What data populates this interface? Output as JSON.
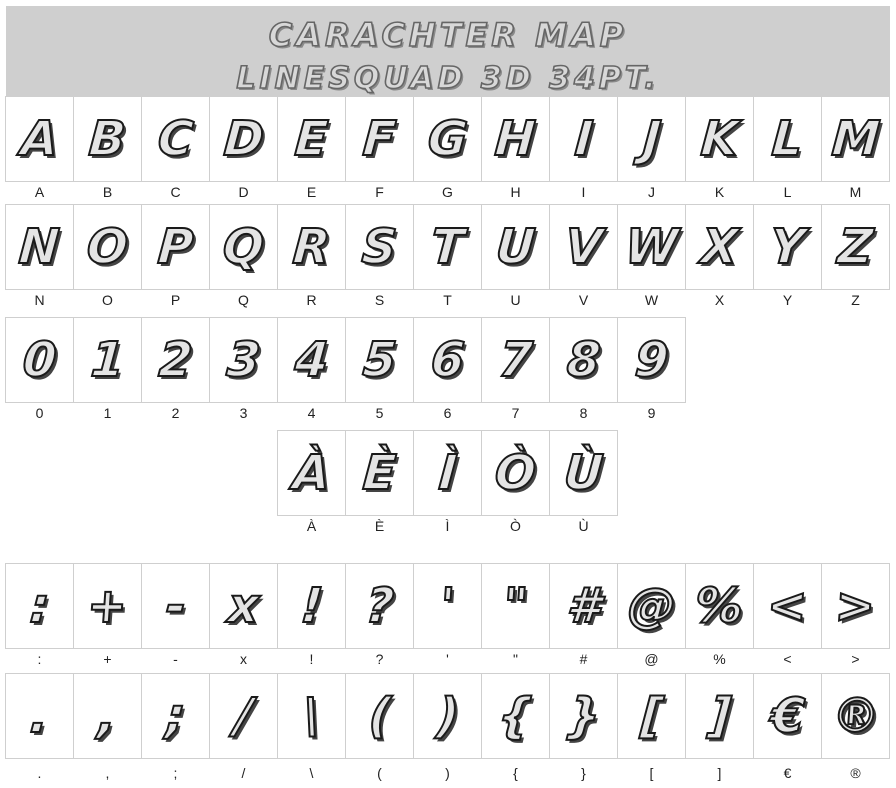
{
  "header": {
    "title_line1": "CARACHTER MAP",
    "title_line2": "LINESQUAD 3D 34PT."
  },
  "rows": [
    {
      "id": "uppercase-1",
      "start": 0,
      "glyphs": [
        {
          "char": "A",
          "label": "A"
        },
        {
          "char": "B",
          "label": "B"
        },
        {
          "char": "C",
          "label": "C"
        },
        {
          "char": "D",
          "label": "D"
        },
        {
          "char": "E",
          "label": "E"
        },
        {
          "char": "F",
          "label": "F"
        },
        {
          "char": "G",
          "label": "G"
        },
        {
          "char": "H",
          "label": "H"
        },
        {
          "char": "I",
          "label": "I"
        },
        {
          "char": "J",
          "label": "J"
        },
        {
          "char": "K",
          "label": "K"
        },
        {
          "char": "L",
          "label": "L"
        },
        {
          "char": "M",
          "label": "M"
        }
      ]
    },
    {
      "id": "uppercase-2",
      "start": 0,
      "glyphs": [
        {
          "char": "N",
          "label": "N"
        },
        {
          "char": "O",
          "label": "O"
        },
        {
          "char": "P",
          "label": "P"
        },
        {
          "char": "Q",
          "label": "Q"
        },
        {
          "char": "R",
          "label": "R"
        },
        {
          "char": "S",
          "label": "S"
        },
        {
          "char": "T",
          "label": "T"
        },
        {
          "char": "U",
          "label": "U"
        },
        {
          "char": "V",
          "label": "V"
        },
        {
          "char": "W",
          "label": "W"
        },
        {
          "char": "X",
          "label": "X"
        },
        {
          "char": "Y",
          "label": "Y"
        },
        {
          "char": "Z",
          "label": "Z"
        }
      ]
    },
    {
      "id": "digits",
      "start": 0,
      "glyphs": [
        {
          "char": "0",
          "label": "0"
        },
        {
          "char": "1",
          "label": "1"
        },
        {
          "char": "2",
          "label": "2"
        },
        {
          "char": "3",
          "label": "3"
        },
        {
          "char": "4",
          "label": "4"
        },
        {
          "char": "5",
          "label": "5"
        },
        {
          "char": "6",
          "label": "6"
        },
        {
          "char": "7",
          "label": "7"
        },
        {
          "char": "8",
          "label": "8"
        },
        {
          "char": "9",
          "label": "9"
        }
      ]
    },
    {
      "id": "accented",
      "start": 4,
      "glyphs": [
        {
          "char": "À",
          "label": "À"
        },
        {
          "char": "È",
          "label": "È"
        },
        {
          "char": "Ì",
          "label": "Ì"
        },
        {
          "char": "Ò",
          "label": "Ò"
        },
        {
          "char": "Ù",
          "label": "Ù"
        }
      ]
    },
    {
      "id": "symbols-1",
      "start": 0,
      "glyphs": [
        {
          "char": ":",
          "label": ":"
        },
        {
          "char": "+",
          "label": "+"
        },
        {
          "char": "-",
          "label": "-"
        },
        {
          "char": "x",
          "label": "x"
        },
        {
          "char": "!",
          "label": "!"
        },
        {
          "char": "?",
          "label": "?"
        },
        {
          "char": "'",
          "label": "'"
        },
        {
          "char": "\"",
          "label": "\""
        },
        {
          "char": "#",
          "label": "#"
        },
        {
          "char": "@",
          "label": "@"
        },
        {
          "char": "%",
          "label": "%"
        },
        {
          "char": "<",
          "label": "<"
        },
        {
          "char": ">",
          "label": ">"
        }
      ]
    },
    {
      "id": "symbols-2",
      "start": 0,
      "glyphs": [
        {
          "char": ".",
          "label": "."
        },
        {
          "char": ",",
          "label": ","
        },
        {
          "char": ";",
          "label": ";"
        },
        {
          "char": "/",
          "label": "/"
        },
        {
          "char": "\\",
          "label": "\\"
        },
        {
          "char": "(",
          "label": "("
        },
        {
          "char": ")",
          "label": ")"
        },
        {
          "char": "{",
          "label": "{"
        },
        {
          "char": "}",
          "label": "}"
        },
        {
          "char": "[",
          "label": "["
        },
        {
          "char": "]",
          "label": "]"
        },
        {
          "char": "€",
          "label": "€"
        },
        {
          "char": "®",
          "label": "®"
        }
      ]
    }
  ]
}
